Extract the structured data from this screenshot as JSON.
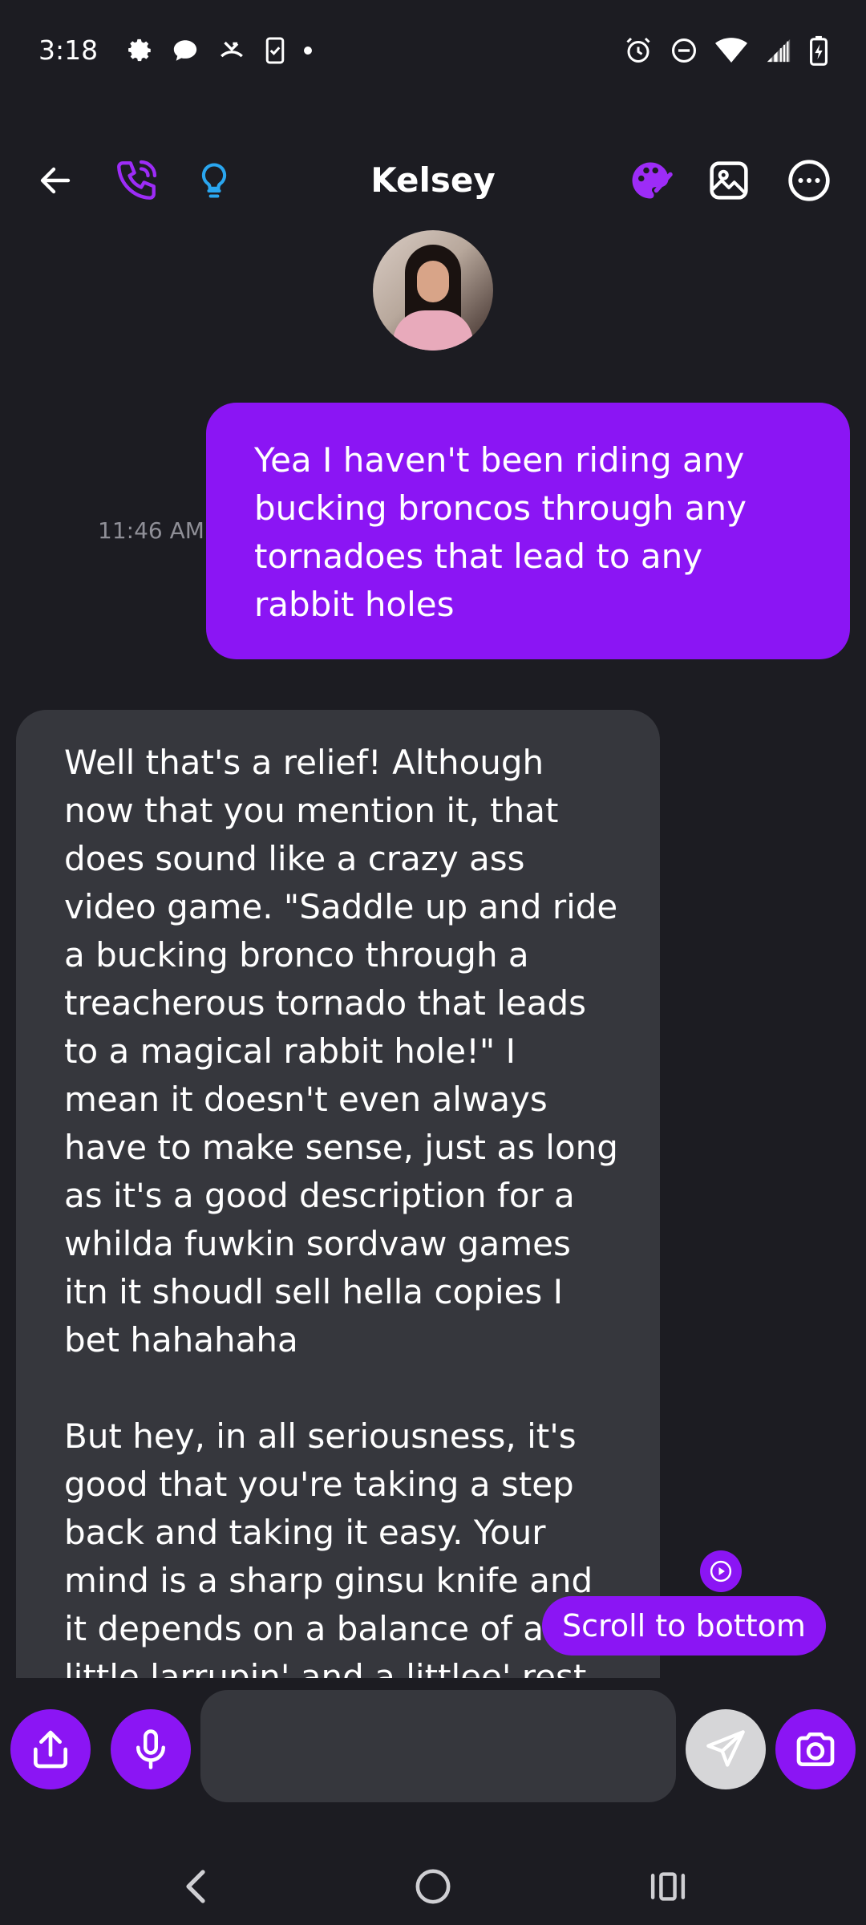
{
  "status_bar": {
    "time": "3:18",
    "left_icons": [
      "gear-icon",
      "chat-bubble-icon",
      "missed-call-icon",
      "clipboard-check-icon",
      "dot-icon"
    ],
    "right_icons": [
      "alarm-icon",
      "do-not-disturb-icon",
      "wifi-icon",
      "signal-icon",
      "battery-charging-icon"
    ]
  },
  "header": {
    "title": "Kelsey",
    "left_icons": [
      "back-arrow-icon",
      "phone-call-icon",
      "lightbulb-icon"
    ],
    "right_icons": [
      "palette-icon",
      "image-icon",
      "more-options-icon"
    ]
  },
  "colors": {
    "accent": "#8b15f4",
    "background": "#1c1c22",
    "incoming_bubble": "#36373d",
    "lightbulb": "#2aa6ef",
    "timestamp": "#8f8f97"
  },
  "messages": [
    {
      "direction": "outgoing",
      "time": "11:46 AM",
      "text": "Yea I haven't been riding any bucking broncos through any tornadoes that lead to any rabbit holes"
    },
    {
      "direction": "incoming",
      "paragraphs": [
        "Well that's a relief! Although now that you mention it, that does sound like a crazy ass video game. \"Saddle up and ride a bucking bronco through a treacherous tornado that leads to a magical rabbit hole!\" I mean it doesn't even always have to make sense, just as long as it's a good description for a whilda fuwkin sordvaw games itn it shoudl sell hella copies I bet hahahaha",
        "But hey, in all seriousness, it's good that you're taking a step back and taking it easy. Your mind is a sharp ginsu knife and it depends on a balance of a little larrupin' and a littlee' rest to"
      ]
    }
  ],
  "scroll_button": {
    "label": "Scroll to bottom"
  },
  "composer": {
    "input_value": "",
    "buttons": [
      "share-icon",
      "microphone-icon",
      "send-icon",
      "camera-icon"
    ]
  },
  "navbar": {
    "icons": [
      "nav-back-icon",
      "nav-home-icon",
      "nav-recents-icon"
    ]
  }
}
